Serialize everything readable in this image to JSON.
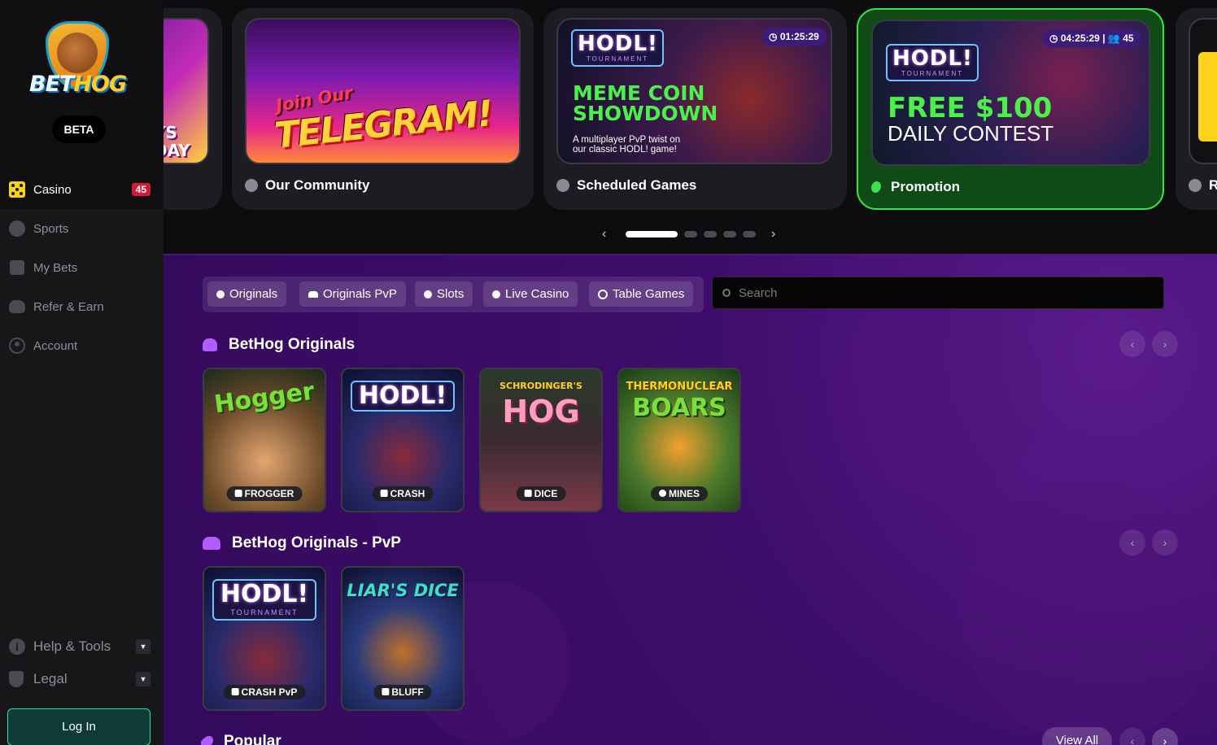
{
  "sidebar": {
    "logo": {
      "text_bet": "BET",
      "text_hog": "HOG",
      "badge": "BETA"
    },
    "nav": [
      {
        "label": "Casino",
        "badge": "45",
        "active": true,
        "icon": "dice-icon"
      },
      {
        "label": "Sports",
        "icon": "ball-icon"
      },
      {
        "label": "My Bets",
        "icon": "document-icon"
      },
      {
        "label": "Refer & Earn",
        "icon": "piggy-bank-icon"
      },
      {
        "label": "Account",
        "icon": "user-circle-icon"
      }
    ],
    "bottom": [
      {
        "label": "Help & Tools",
        "icon": "info-icon",
        "caret": "▼"
      },
      {
        "label": "Legal",
        "icon": "shield-icon",
        "caret": "▼"
      }
    ],
    "login_label": "Log In"
  },
  "carousel": {
    "cards": [
      {
        "label": "",
        "partial_text": "YS DAY"
      },
      {
        "label": "Our Community",
        "art_join": "Join Our",
        "art_main": "TELEGRAM!"
      },
      {
        "label": "Scheduled Games",
        "timer": "01:25:29",
        "hodl_big": "HODL!",
        "hodl_small": "TOURNAMENT",
        "title_line1": "MEME COIN",
        "title_line2": "SHOWDOWN",
        "subtitle_line1": "A multiplayer PvP twist on",
        "subtitle_line2": "our classic HODL! game!"
      },
      {
        "label": "Promotion",
        "timer": "04:25:29",
        "players": "45",
        "hodl_big": "HODL!",
        "hodl_small": "TOURNAMENT",
        "title_line1": "FREE $100",
        "title_line2": "DAILY CONTEST"
      },
      {
        "label": "Re"
      }
    ],
    "prev_arrow": "‹",
    "next_arrow": "›",
    "active_dot": 0
  },
  "filters": {
    "chips": [
      "Originals",
      "Originals PvP",
      "Slots",
      "Live Casino",
      "Table Games"
    ],
    "search_placeholder": "Search"
  },
  "sections": [
    {
      "title": "BetHog Originals",
      "games": [
        {
          "name": "FROGGER",
          "art": "Hogger"
        },
        {
          "name": "CRASH",
          "art_big": "HODL!"
        },
        {
          "name": "DICE",
          "art_top": "SCHRODINGER'S",
          "art_big": "HOG"
        },
        {
          "name": "MINES",
          "art_top": "THERMONUCLEAR",
          "art_big": "BOARS"
        }
      ]
    },
    {
      "title": "BetHog Originals - PvP",
      "games": [
        {
          "name": "CRASH PvP",
          "art_big": "HODL!",
          "art_small": "TOURNAMENT"
        },
        {
          "name": "BLUFF",
          "art_big": "LIAR'S DICE"
        }
      ]
    },
    {
      "title": "Popular",
      "view_all": "View All"
    }
  ],
  "colors": {
    "accent_green": "#37e34b",
    "casino_badge_red": "#d21a35",
    "main_purple": "#3e0d6b",
    "login_border": "#22e6b2"
  }
}
